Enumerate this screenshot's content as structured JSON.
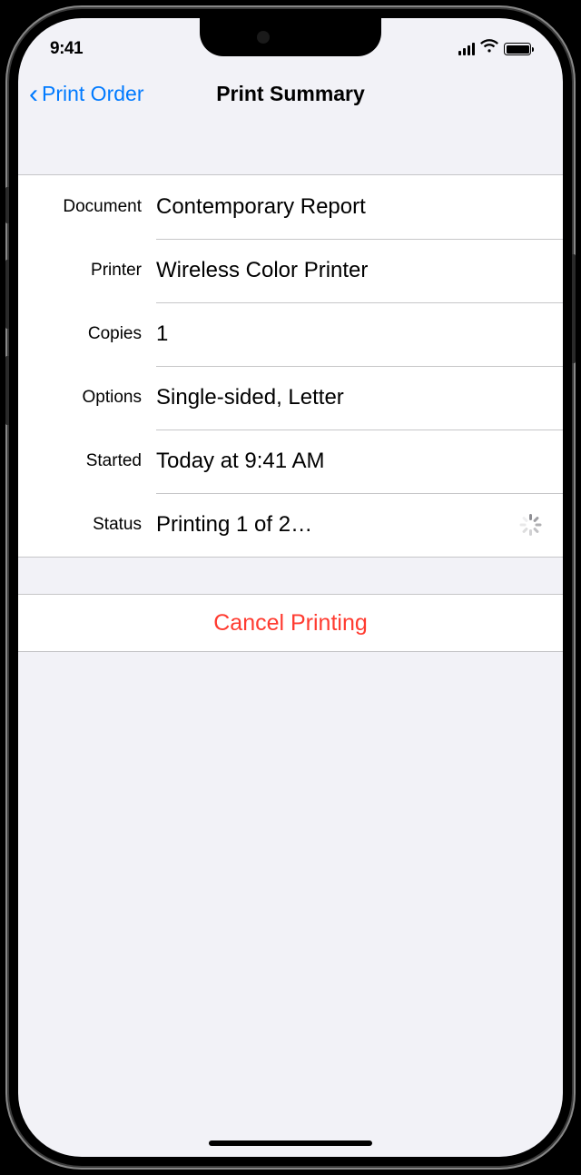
{
  "status_bar": {
    "time": "9:41"
  },
  "nav": {
    "back_label": "Print Order",
    "title": "Print Summary"
  },
  "rows": {
    "document": {
      "label": "Document",
      "value": "Contemporary Report"
    },
    "printer": {
      "label": "Printer",
      "value": "Wireless Color Printer"
    },
    "copies": {
      "label": "Copies",
      "value": "1"
    },
    "options": {
      "label": "Options",
      "value": "Single-sided, Letter"
    },
    "started": {
      "label": "Started",
      "value": "Today at  9:41 AM"
    },
    "status": {
      "label": "Status",
      "value": "Printing 1 of 2…"
    }
  },
  "actions": {
    "cancel_label": "Cancel Printing"
  }
}
